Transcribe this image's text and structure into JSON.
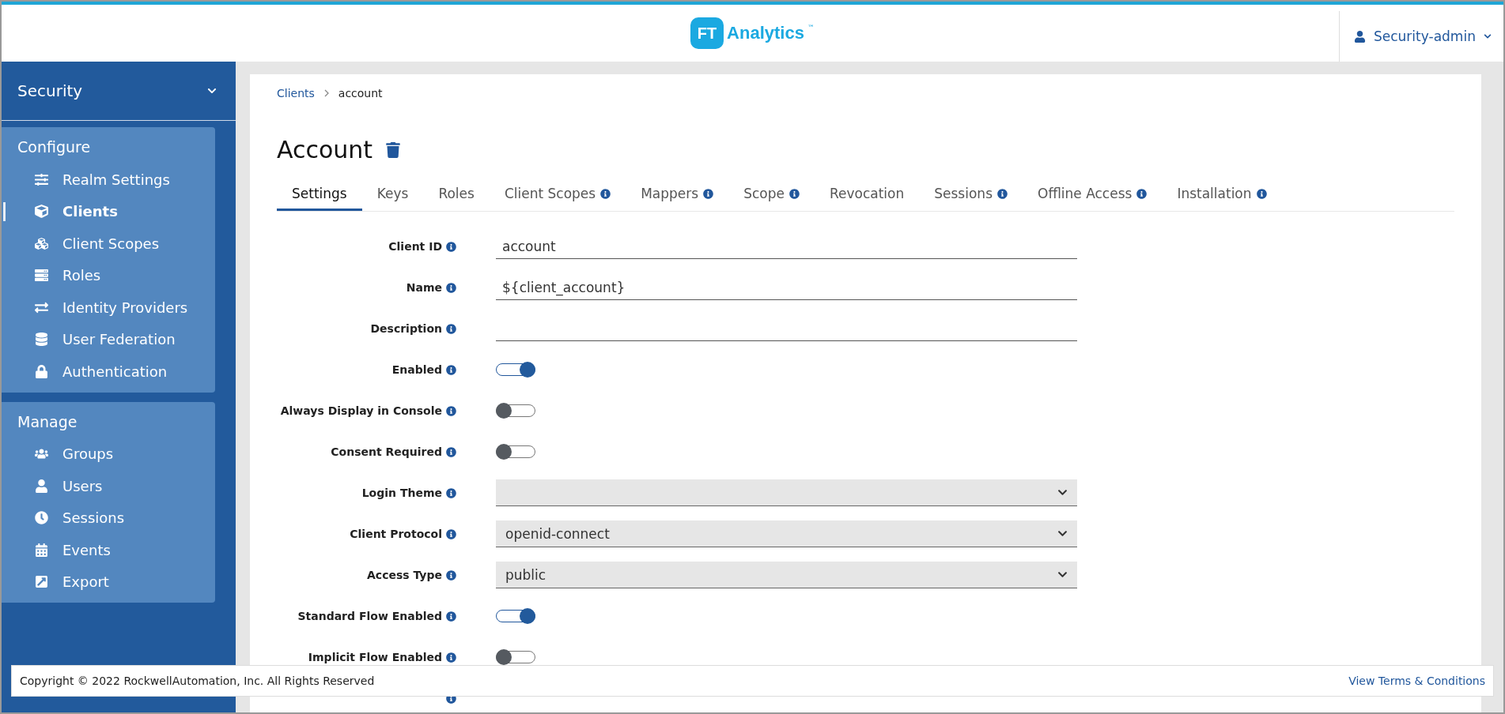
{
  "header": {
    "logo": {
      "mark": "FT",
      "name": "Analytics",
      "tm": "™"
    },
    "user": "Security-admin"
  },
  "sidebar": {
    "realm": "Security",
    "sections": [
      {
        "title": "Configure",
        "items": [
          {
            "label": "Realm Settings",
            "selected": false
          },
          {
            "label": "Clients",
            "selected": true
          },
          {
            "label": "Client Scopes",
            "selected": false
          },
          {
            "label": "Roles",
            "selected": false
          },
          {
            "label": "Identity Providers",
            "selected": false
          },
          {
            "label": "User Federation",
            "selected": false
          },
          {
            "label": "Authentication",
            "selected": false
          }
        ]
      },
      {
        "title": "Manage",
        "items": [
          {
            "label": "Groups",
            "selected": false
          },
          {
            "label": "Users",
            "selected": false
          },
          {
            "label": "Sessions",
            "selected": false
          },
          {
            "label": "Events",
            "selected": false
          },
          {
            "label": "Export",
            "selected": false
          }
        ]
      }
    ]
  },
  "breadcrumb": [
    {
      "label": "Clients",
      "link": true
    },
    {
      "label": "account",
      "link": false
    }
  ],
  "title": "Account",
  "tabs": [
    {
      "label": "Settings",
      "selected": true,
      "info": false
    },
    {
      "label": "Keys",
      "selected": false,
      "info": false
    },
    {
      "label": "Roles",
      "selected": false,
      "info": false
    },
    {
      "label": "Client Scopes",
      "selected": false,
      "info": true
    },
    {
      "label": "Mappers",
      "selected": false,
      "info": true
    },
    {
      "label": "Scope",
      "selected": false,
      "info": true
    },
    {
      "label": "Revocation",
      "selected": false,
      "info": false
    },
    {
      "label": "Sessions",
      "selected": false,
      "info": true
    },
    {
      "label": "Offline Access",
      "selected": false,
      "info": true
    },
    {
      "label": "Installation",
      "selected": false,
      "info": true
    }
  ],
  "form": [
    {
      "kind": "text",
      "label": "Client ID",
      "value": "account"
    },
    {
      "kind": "text",
      "label": "Name",
      "value": "${client_account}"
    },
    {
      "kind": "text",
      "label": "Description"
    },
    {
      "kind": "toggle",
      "label": "Enabled",
      "on": true
    },
    {
      "kind": "toggle",
      "label": "Always Display in Console",
      "on": false
    },
    {
      "kind": "toggle",
      "label": "Consent Required",
      "on": false
    },
    {
      "kind": "select",
      "label": "Login Theme"
    },
    {
      "kind": "select",
      "label": "Client Protocol",
      "value": "openid-connect"
    },
    {
      "kind": "select",
      "label": "Access Type",
      "value": "public"
    },
    {
      "kind": "toggle",
      "label": "Standard Flow Enabled",
      "on": true
    },
    {
      "kind": "toggle",
      "label": "Implicit Flow Enabled",
      "on": false
    },
    {
      "kind": "hidden"
    }
  ],
  "footer": {
    "copyright": "Copyright © 2022 RockwellAutomation, Inc. All Rights Reserved",
    "link": "View Terms & Conditions"
  }
}
